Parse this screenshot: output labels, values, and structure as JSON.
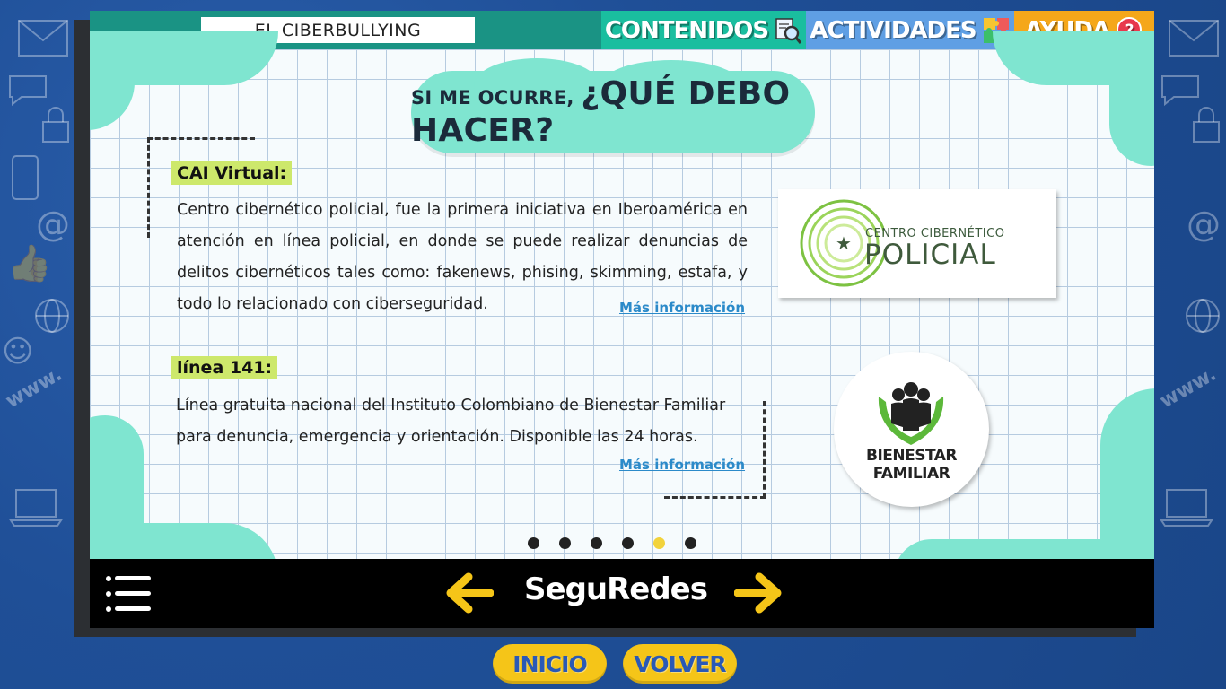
{
  "header": {
    "title": "EL CIBERBULLYING",
    "tabs": [
      {
        "label": "CONTENIDOS",
        "icon": "search-document-icon"
      },
      {
        "label": "ACTIVIDADES",
        "icon": "puzzle-icon"
      },
      {
        "label": "AYUDA",
        "icon": "question-icon"
      }
    ]
  },
  "main": {
    "heading_prefix": "SI ME OCURRE,",
    "heading_q": "¿QUÉ DEBO HACER?",
    "sections": [
      {
        "tag": "CAI Virtual:",
        "text": "Centro cibernético policial, fue la primera iniciativa en Iberoamérica en atención en línea policial, en donde se puede realizar denuncias de delitos cibernéticos tales como: fakenews, phising, skimming, estafa, y todo lo relacionado con ciberseguridad.",
        "link": "Más información"
      },
      {
        "tag": "línea 141:",
        "text": "Línea gratuita nacional  del Instituto Colombiano de Bienestar Familiar para denuncia, emergencia y orientación. Disponible las 24 horas.",
        "link": "Más información"
      }
    ],
    "logos": {
      "policial_line1": "CENTRO CIBERNÉTICO",
      "policial_line2": "POLICIAL",
      "bienestar_line1": "BIENESTAR",
      "bienestar_line2": "FAMILIAR"
    },
    "pagination": {
      "total": 6,
      "active": 5
    }
  },
  "footer": {
    "brand": "SeguRedes"
  },
  "buttons": {
    "inicio": "INICIO",
    "volver": "VOLVER"
  },
  "colors": {
    "accent_teal": "#1a9384",
    "mint": "#7fe5d0",
    "yellow": "#f5c518",
    "tag_green": "#cde86b",
    "link_blue": "#2b8ac9"
  }
}
